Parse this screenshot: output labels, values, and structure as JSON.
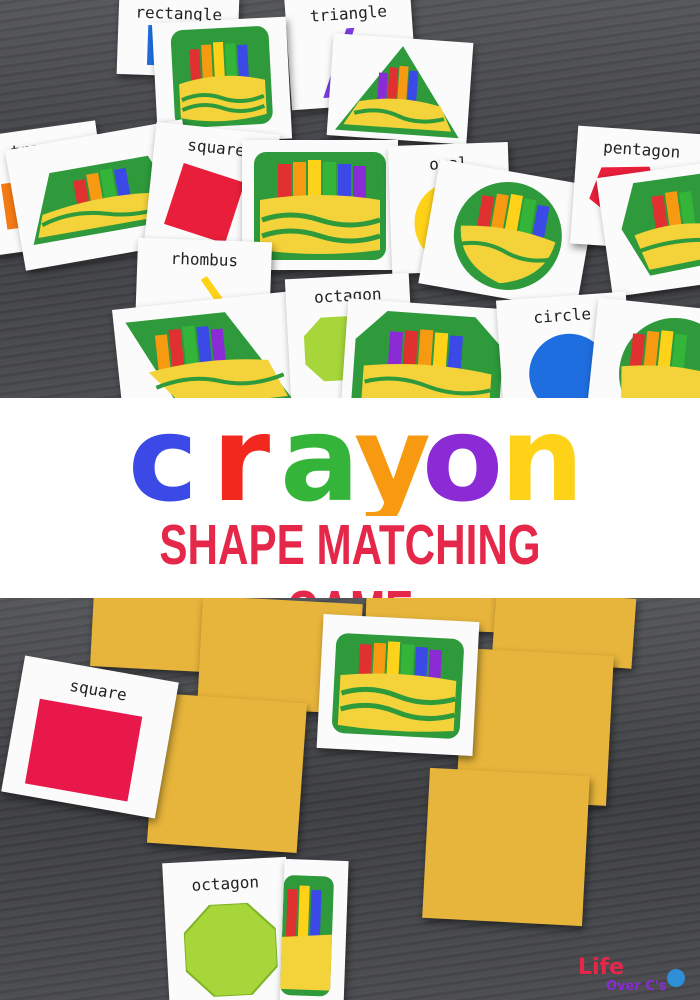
{
  "title": {
    "word": "crayon",
    "letters": [
      {
        "char": "c",
        "color": "#3b49e6"
      },
      {
        "char": "r",
        "color": "#f2281f"
      },
      {
        "char": "a",
        "color": "#34b53a"
      },
      {
        "char": "y",
        "color": "#f79a12"
      },
      {
        "char": "o",
        "color": "#8a2bd6"
      },
      {
        "char": "n",
        "color": "#ffd21a"
      }
    ],
    "subtitle": "SHAPE MATCHING GAME",
    "subtitle_color": "#e5284a"
  },
  "top_cards": {
    "rectangle": "rectangle",
    "triangle": "triangle",
    "trapezoid": "trapez",
    "square": "square",
    "oval": "oval",
    "pentagon": "pentagon",
    "rhombus": "rhombus",
    "octagon": "octagon",
    "circle": "circle"
  },
  "bottom_cards": {
    "square": "square",
    "octagon": "octagon"
  },
  "logo": {
    "line1": "Life",
    "line2": "Over C's"
  },
  "colors": {
    "crayon_green": "#2e9a3b",
    "crayon_yellow": "#f4d23a",
    "card_cover": "#e7b53b",
    "square_red": "#e8184a",
    "octagon_green": "#a6d63a"
  }
}
